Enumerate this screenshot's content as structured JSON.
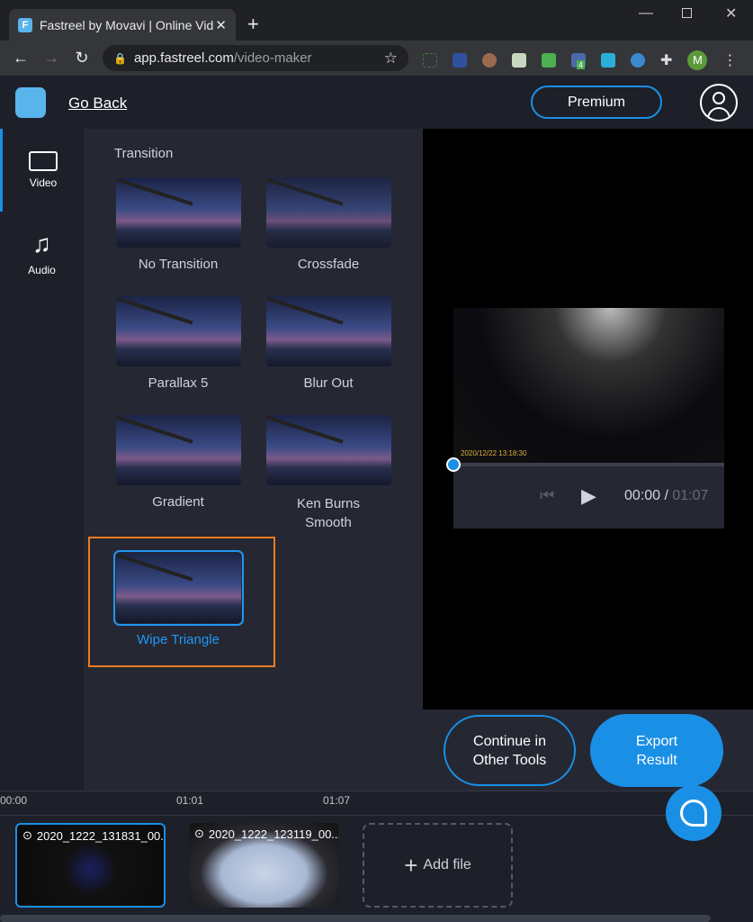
{
  "browser": {
    "tab_title": "Fastreel by Movavi | Online Vid",
    "tab_favicon": "F",
    "url_host": "app.fastreel.com",
    "url_path": "/video-maker",
    "ext_badge": "4",
    "profile_initial": "M"
  },
  "header": {
    "go_back": "Go Back",
    "premium": "Premium"
  },
  "sidebar": {
    "items": [
      {
        "label": "Video",
        "icon": "video-camera-icon",
        "active": true
      },
      {
        "label": "Audio",
        "icon": "music-note-icon",
        "active": false
      }
    ]
  },
  "panel": {
    "title": "Transition",
    "transitions": [
      {
        "label": "No Transition"
      },
      {
        "label": "Crossfade"
      },
      {
        "label": "Parallax 5"
      },
      {
        "label": "Blur Out"
      },
      {
        "label": "Gradient"
      },
      {
        "label": "Ken Burns Smooth"
      },
      {
        "label": "Wipe Triangle",
        "selected": true
      }
    ],
    "selected_color": "#2196f3",
    "highlight_color": "#f07a22"
  },
  "player": {
    "timestamp_overlay": "2020/12/22 13:18:30",
    "current_time": "00:00",
    "separator": "/",
    "total_time": "01:07",
    "progress": 0
  },
  "actions": {
    "continue": "Continue in Other Tools",
    "export": "Export Result"
  },
  "timeline": {
    "ticks": [
      "00:00",
      "01:01",
      "01:07"
    ],
    "clips": [
      {
        "name": "2020_1222_131831_00..."
      },
      {
        "name": "2020_1222_123119_00..."
      }
    ],
    "add_file": "Add file"
  },
  "colors": {
    "accent": "#1a8fe6",
    "background": "#1d2029",
    "panel": "#252833"
  }
}
